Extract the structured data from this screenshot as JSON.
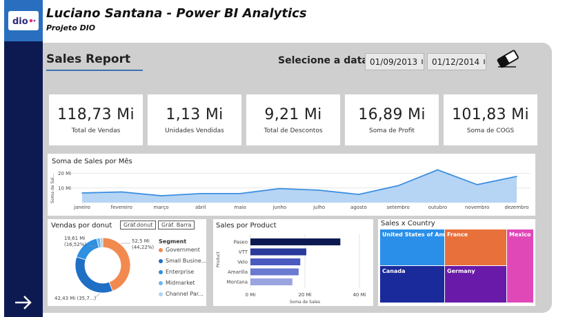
{
  "header": {
    "title": "Luciano Santana - Power BI Analytics",
    "subtitle": "Projeto DIO"
  },
  "logo": {
    "text": "dio"
  },
  "report": {
    "title": "Sales Report"
  },
  "date_filter": {
    "label": "Selecione a data",
    "start": "01/09/2013",
    "end": "01/12/2014"
  },
  "kpis": [
    {
      "value": "118,73 Mi",
      "label": "Total de Vendas"
    },
    {
      "value": "1,13 Mi",
      "label": "Unidades Vendidas"
    },
    {
      "value": "9,21 Mi",
      "label": "Total de Descontos"
    },
    {
      "value": "16,89 Mi",
      "label": "Soma de Profit"
    },
    {
      "value": "101,83 Mi",
      "label": "Soma de COGS"
    }
  ],
  "monthly": {
    "title": "Soma de Sales por Mês",
    "ylabel": "Soma de Sal...",
    "yticks": [
      "20 Mi",
      "10 Mi"
    ],
    "color": "#3b8fe0"
  },
  "donut": {
    "title": "Vendas por donut",
    "btn1": "Gráf.donut",
    "btn2": "Gráf. Barra",
    "legend_title": "Segment",
    "label_left": "19,61 Mi",
    "label_left_pct": "(16,52%)",
    "label_right": "52,5 Mi",
    "label_right_pct": "(44,22%)",
    "label_bottom": "42,43 Mi (35,7...)"
  },
  "bars": {
    "title": "Sales por Product",
    "ylabel": "Product",
    "xlabel": "Soma de Sales",
    "xticks": [
      "0 Mi",
      "20 Mi",
      "40 Mi"
    ]
  },
  "treemap": {
    "title": "Sales x Country",
    "cells": [
      {
        "label": "United States of Ame...",
        "color": "#2a8fe8"
      },
      {
        "label": "France",
        "color": "#e8703a"
      },
      {
        "label": "Mexico",
        "color": "#e048b8"
      },
      {
        "label": "Canada",
        "color": "#1a2a9a"
      },
      {
        "label": "Germany",
        "color": "#6a1aa8"
      }
    ]
  },
  "chart_data": [
    {
      "type": "area",
      "title": "Soma de Sales por Mês",
      "x": [
        "janeiro",
        "fevereiro",
        "março",
        "abril",
        "maio",
        "junho",
        "julho",
        "agosto",
        "setembro",
        "outubro",
        "novembro",
        "dezembro"
      ],
      "values": [
        6.6,
        7.3,
        4.7,
        6.2,
        6.2,
        9.6,
        8.5,
        5.6,
        11.6,
        22.4,
        12.3,
        17.9
      ],
      "ylabel": "Soma de Sal...",
      "ylim": [
        0,
        25
      ]
    },
    {
      "type": "pie",
      "title": "Vendas por donut",
      "legend_title": "Segment",
      "categories": [
        "Government",
        "Small Business",
        "Enterprise",
        "Midmarket",
        "Channel Partners"
      ],
      "category_labels": [
        "Government",
        "Small Busine...",
        "Enterprise",
        "Midmarket",
        "Channel Par..."
      ],
      "values": [
        52.5,
        42.43,
        19.61,
        2.38,
        1.8
      ],
      "colors": [
        "#f28a50",
        "#1f6fc4",
        "#2f8fe0",
        "#6cb6f0",
        "#a8d4f7"
      ]
    },
    {
      "type": "bar",
      "title": "Sales por Product",
      "categories": [
        "Paseo",
        "VTT",
        "Velo",
        "Amarilla",
        "Montana"
      ],
      "values": [
        33.0,
        20.5,
        18.3,
        17.7,
        15.4
      ],
      "colors": [
        "#0d1a52",
        "#2a3a9a",
        "#4a5ac0",
        "#6a7ad0",
        "#9aa5e0"
      ],
      "xlabel": "Soma de Sales",
      "ylabel": "Product",
      "xlim": [
        0,
        40
      ]
    }
  ]
}
